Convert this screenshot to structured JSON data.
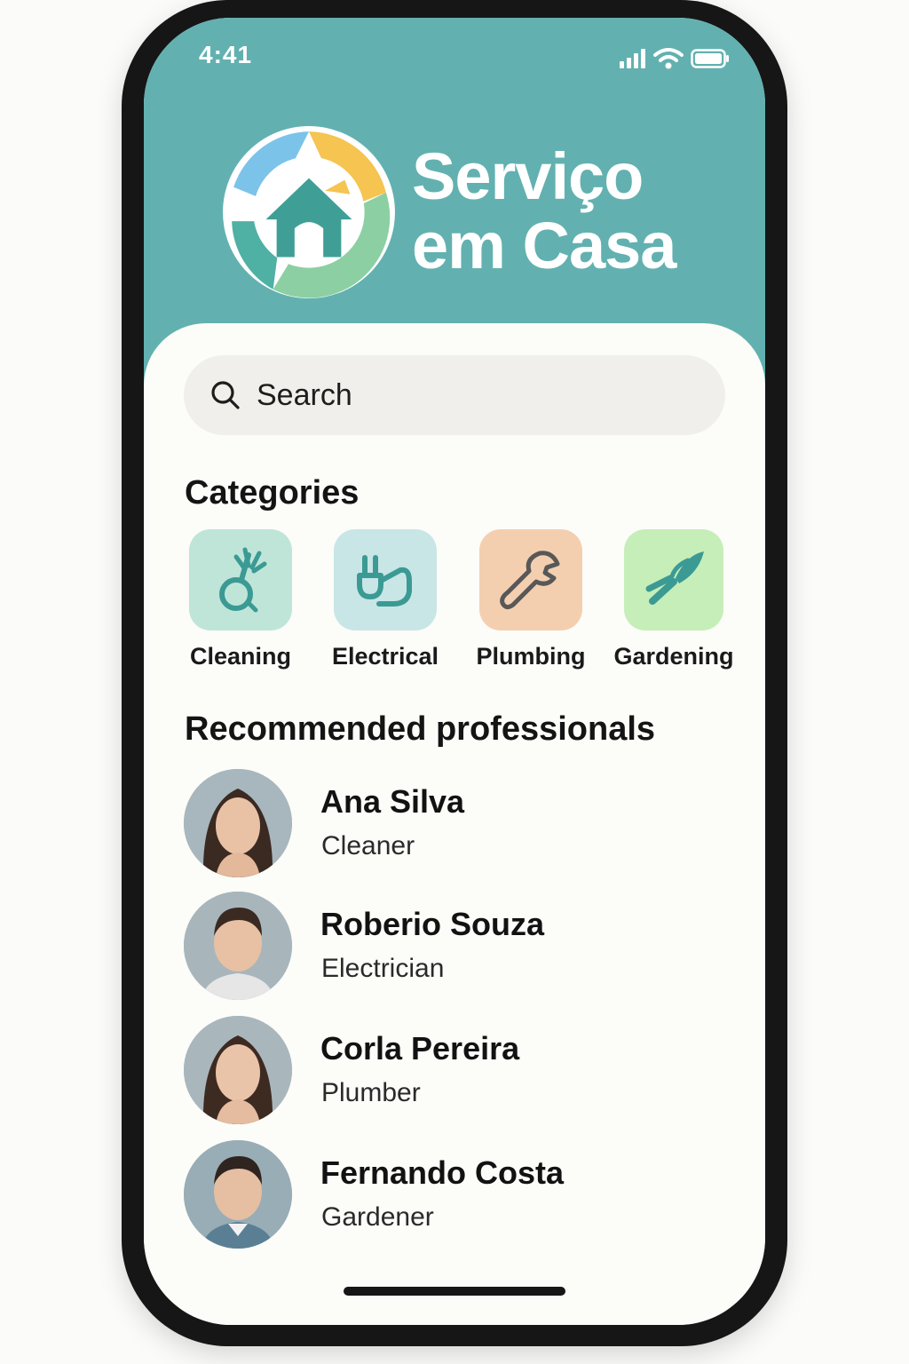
{
  "status_bar": {
    "time": "4:41"
  },
  "brand": {
    "line1": "Serviço",
    "line2": "em Casa"
  },
  "search": {
    "placeholder": "Search",
    "icon": "search-icon"
  },
  "categories": {
    "title": "Categories",
    "items": [
      {
        "label": "Cleaning",
        "icon": "broom-icon",
        "color": "#bfe5d9"
      },
      {
        "label": "Electrical",
        "icon": "plug-icon",
        "color": "#c8e6e6"
      },
      {
        "label": "Plumbing",
        "icon": "wrench-icon",
        "color": "#f4cfaf"
      },
      {
        "label": "Gardening",
        "icon": "pruning-shears-icon",
        "color": "#c6eeb8"
      }
    ]
  },
  "recommended": {
    "title": "Recommended professionals",
    "items": [
      {
        "name": "Ana Silva",
        "role": "Cleaner"
      },
      {
        "name": "Roberio Souza",
        "role": "Electrician"
      },
      {
        "name": "Corla Pereira",
        "role": "Plumber"
      },
      {
        "name": "Fernando Costa",
        "role": "Gardener"
      }
    ]
  },
  "colors": {
    "header": "#62b1b0",
    "accent": "#3b9a94",
    "background": "#fcfcf9"
  }
}
